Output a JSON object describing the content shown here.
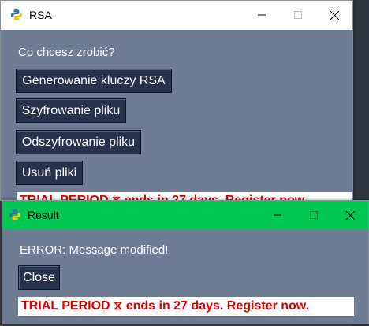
{
  "main_window": {
    "title": "RSA",
    "prompt": "Co chcesz zrobić?",
    "buttons": [
      "Generowanie kluczy RSA",
      "Szyfrowanie pliku",
      "Odszyfrowanie pliku",
      "Usuń pliki"
    ],
    "trial": "TRIAL PERIOD ⧖ ends in 27 days. Register now.",
    "colors": {
      "titlebar": "#ffffff",
      "client": "#6e7c94"
    }
  },
  "result_window": {
    "title": "Result",
    "message": "ERROR: Message modified!",
    "close_label": "Close",
    "trial": "TRIAL PERIOD ⧖ ends in 27 days. Register now.",
    "colors": {
      "titlebar": "#00c853",
      "client": "#6e7c94"
    }
  },
  "icons": {
    "app": "python-icon",
    "minimize": "minimize-icon",
    "maximize": "maximize-icon",
    "close": "close-icon"
  }
}
